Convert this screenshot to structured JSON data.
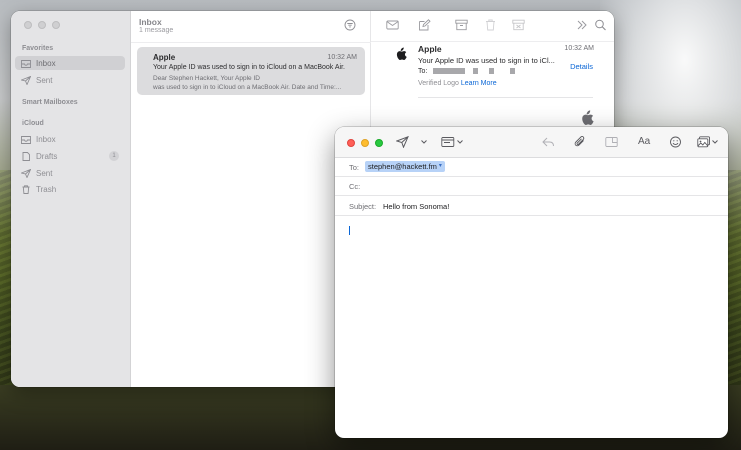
{
  "mail": {
    "sidebar": {
      "favorites_heading": "Favorites",
      "favorites": [
        {
          "label": "Inbox",
          "icon": "inbox-icon",
          "selected": true
        },
        {
          "label": "Sent",
          "icon": "paperplane-icon",
          "selected": false
        }
      ],
      "smart_mailboxes_heading": "Smart Mailboxes",
      "icloud_heading": "iCloud",
      "icloud": [
        {
          "label": "Inbox",
          "icon": "inbox-icon"
        },
        {
          "label": "Drafts",
          "icon": "document-icon",
          "badge": "1"
        },
        {
          "label": "Sent",
          "icon": "paperplane-icon"
        },
        {
          "label": "Trash",
          "icon": "trash-icon"
        }
      ]
    },
    "list": {
      "title": "Inbox",
      "subtitle": "1 message",
      "message": {
        "from": "Apple",
        "time": "10:32 AM",
        "subject": "Your Apple ID was used to sign in to iCloud on a MacBook Air.",
        "preview_line1": "Dear Stephen Hackett, Your Apple ID",
        "preview_line2": "was used to sign in to iCloud on a MacBook Air. Date and Time:..."
      }
    },
    "reading": {
      "from": "Apple",
      "time": "10:32 AM",
      "subject": "Your Apple ID was used to sign in to iCl...",
      "to_label": "To:",
      "details_label": "Details",
      "verified_label": "Verified Logo",
      "learn_more": "Learn More"
    }
  },
  "compose": {
    "to_label": "To:",
    "to_value": "stephen@hackett.fm",
    "cc_label": "Cc:",
    "subject_label": "Subject:",
    "subject_value": "Hello from Sonoma!",
    "format_label": "Aa"
  }
}
